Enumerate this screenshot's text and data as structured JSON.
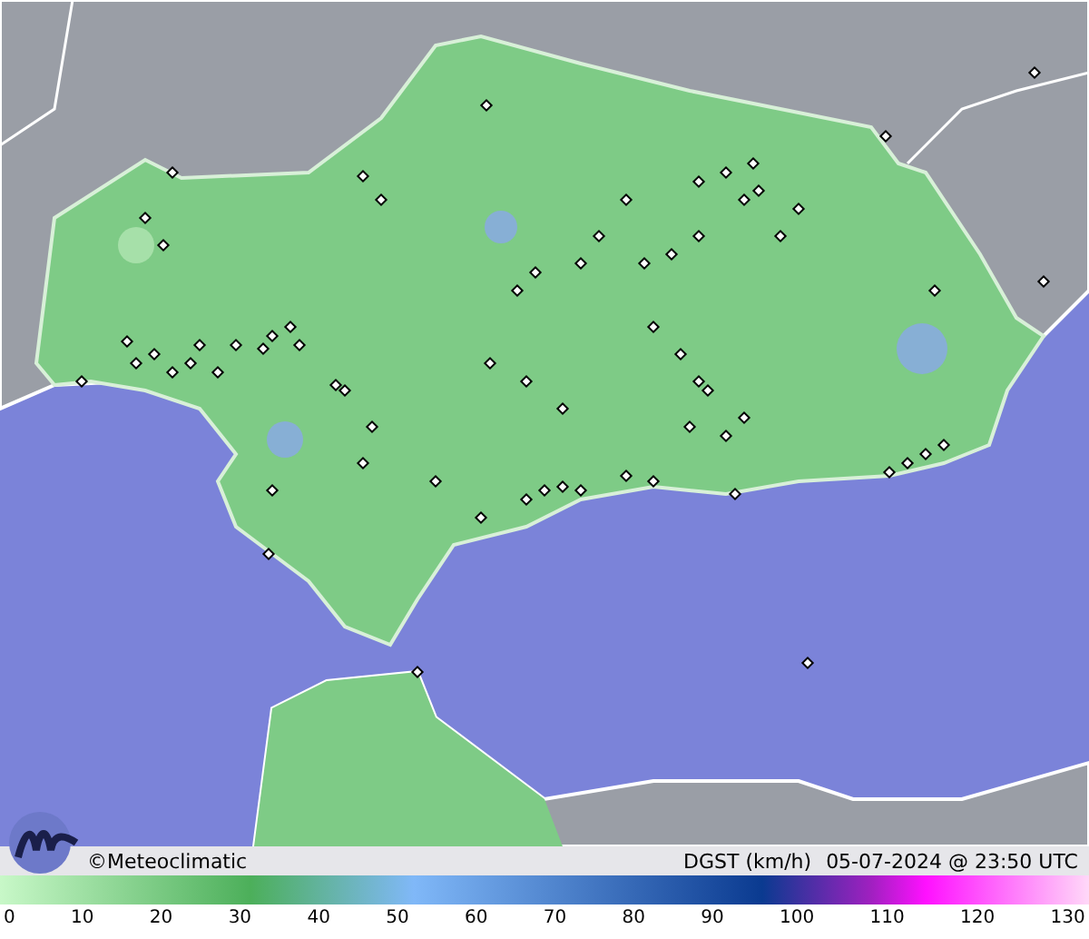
{
  "credit": "©Meteoclimatic",
  "variable": "DGST (km/h)",
  "timestamp": "05-07-2024 @ 23:50 UTC",
  "scale_ticks": [
    "0",
    "10",
    "20",
    "30",
    "40",
    "50",
    "60",
    "70",
    "80",
    "90",
    "100",
    "110",
    "120",
    "130"
  ]
}
